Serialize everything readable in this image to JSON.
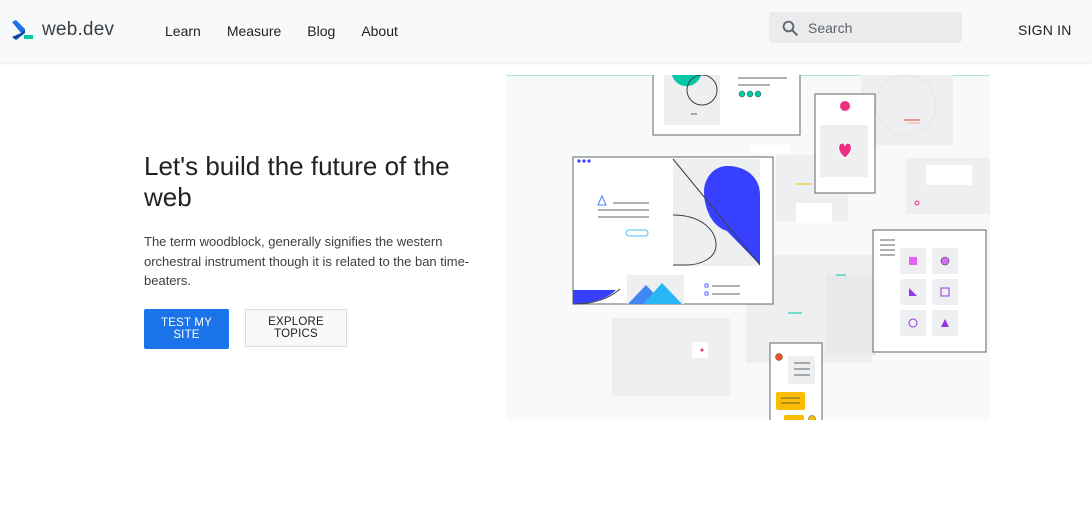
{
  "header": {
    "logo_text": "web.dev",
    "nav": [
      {
        "label": "Learn"
      },
      {
        "label": "Measure"
      },
      {
        "label": "Blog"
      },
      {
        "label": "About"
      }
    ],
    "search": {
      "placeholder": "Search"
    },
    "signin_label": "SIGN IN"
  },
  "hero": {
    "title": "Let's build the future of the web",
    "description": "The term woodblock, generally signifies the western orchestral instrument though it is related to the ban time-beaters.",
    "primary_button": "TEST MY SITE",
    "secondary_button": "EXPLORE TOPICS"
  },
  "colors": {
    "brand_blue": "#1a73e8",
    "logo_dark": "#202124",
    "illus_blue": "#3740ff",
    "illus_teal": "#00c9a7",
    "illus_pink": "#ee2c82",
    "illus_purple": "#9334e6",
    "illus_yellow": "#fbbc04"
  },
  "icons": {
    "logo": "web-dev-chevron-logo-icon",
    "search": "search-icon"
  }
}
